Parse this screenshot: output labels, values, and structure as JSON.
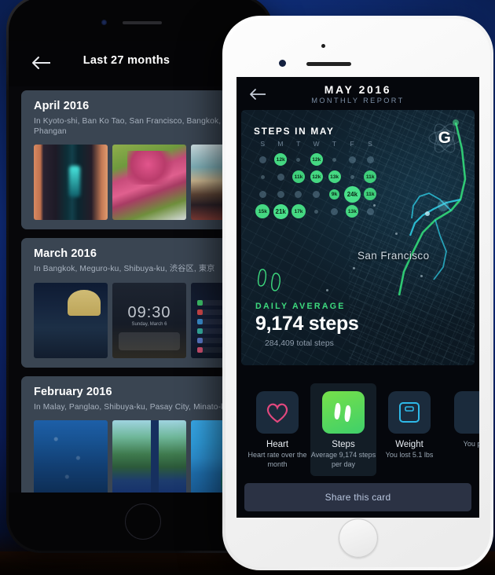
{
  "background": {
    "blue": "#1640b4",
    "dark": "#120803"
  },
  "left_phone": {
    "header": {
      "back_icon": "arrow-left-icon",
      "title": "Last 27 months"
    },
    "cards": [
      {
        "month": "April 2016",
        "places": "In Kyoto-shi, Ban Ko Tao, San Francisco, Bangkok, Ko Phangan",
        "photos": [
          "temple-corridor",
          "cherry-blossom",
          "beach-shore"
        ]
      },
      {
        "month": "March 2016",
        "places": "In Bangkok, Meguro-ku, Shibuya-ku, 渋谷区, 東京",
        "photos": [
          "night-monument",
          "lockscreen-0930",
          "app-list"
        ],
        "lockscreen": {
          "time": "09:30",
          "date": "Sunday, March 6"
        }
      },
      {
        "month": "February 2016",
        "places": "In Malay, Panglao, Shibuya-ku, Pasay City, Minato-ku",
        "photos": [
          "underwater-sea",
          "palm-beach",
          "tropical-pool"
        ]
      }
    ]
  },
  "right_phone": {
    "header": {
      "back_icon": "arrow-left-icon",
      "title": "MAY 2016",
      "subtitle": "MONTHLY REPORT"
    },
    "report": {
      "steps_title": "STEPS IN MAY",
      "brand_logo": "g-atom-logo",
      "map_label": "San Francisco",
      "footprint_icon": "footprints-icon",
      "daily_average_label": "DAILY AVERAGE",
      "daily_average_value": "9,174 steps",
      "total_steps": "284,409 total steps",
      "accent_green": "#3ddb7e"
    },
    "tiles": [
      {
        "icon": "heart-icon",
        "name": "Heart",
        "desc": "Heart rate over the month",
        "selected": false
      },
      {
        "icon": "footprints-icon",
        "name": "Steps",
        "desc": "Average 9,174 steps per day",
        "selected": true
      },
      {
        "icon": "scale-icon",
        "name": "Weight",
        "desc": "You lost 5.1 lbs",
        "selected": false
      },
      {
        "icon": "partial-icon",
        "name": "",
        "desc": "You per",
        "selected": false
      }
    ],
    "share_button": "Share this card"
  },
  "chart_data": {
    "type": "heatmap",
    "title": "STEPS IN MAY",
    "categories": [
      "S",
      "M",
      "T",
      "W",
      "T",
      "F",
      "S"
    ],
    "unit": "steps",
    "daily_average": 9174,
    "total": 284409,
    "weeks": [
      [
        null,
        "12k",
        null,
        "12k",
        null,
        null,
        null
      ],
      [
        null,
        null,
        "11k",
        "12k",
        "13k",
        null,
        "11k"
      ],
      [
        null,
        null,
        null,
        null,
        "9k",
        "24k",
        "11k"
      ],
      [
        "15k",
        "21k",
        "17k",
        null,
        null,
        "13k",
        null
      ]
    ]
  }
}
